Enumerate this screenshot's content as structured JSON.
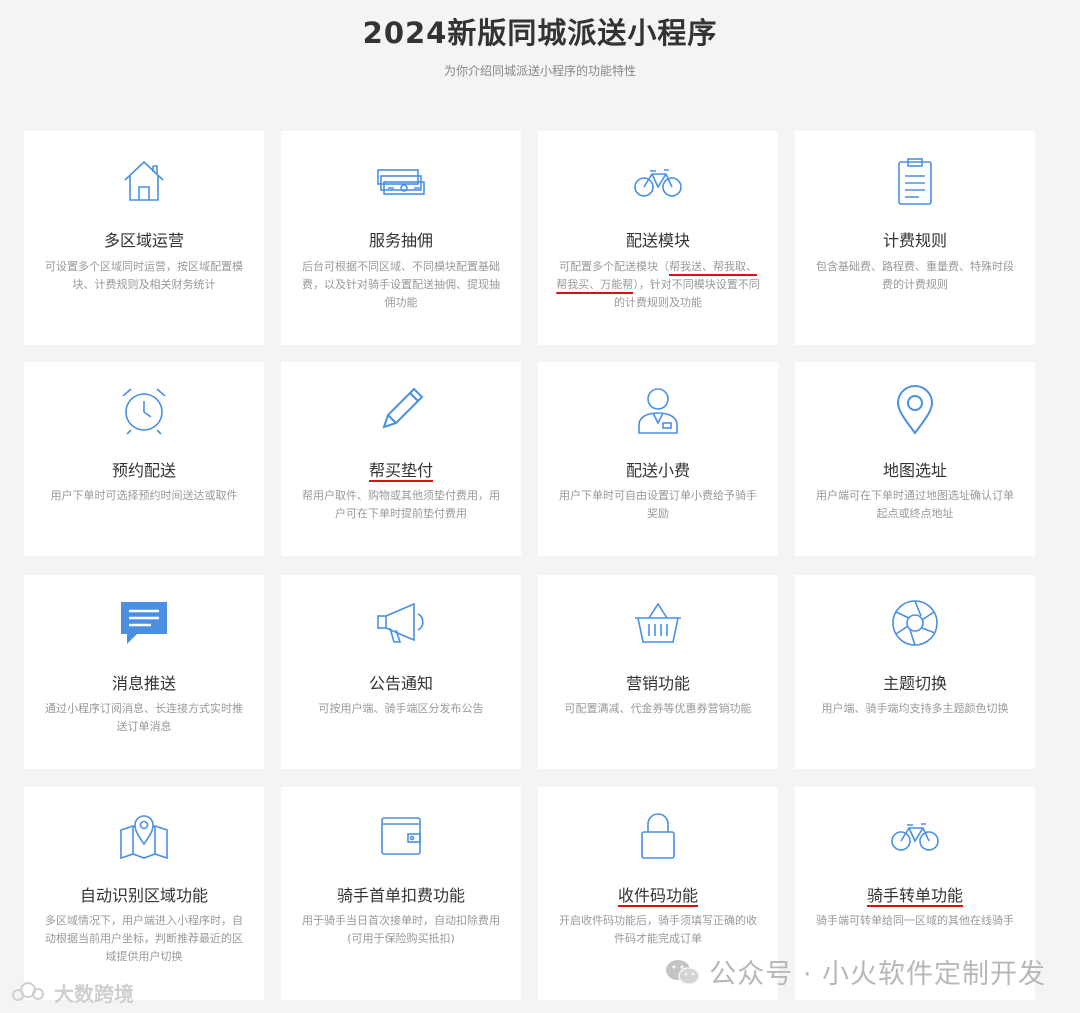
{
  "header": {
    "title": "2024新版同城派送小程序",
    "subtitle": "为你介绍同城派送小程序的功能特性"
  },
  "accent_color": "#4a90e2",
  "highlight_color": "#e01010",
  "cards": [
    {
      "icon": "house-icon",
      "title": "多区域运营",
      "desc": "可设置多个区域同时运营，按区域配置模块、计费规则及相关财务统计"
    },
    {
      "icon": "money-stack-icon",
      "title": "服务抽佣",
      "desc": "后台可根据不同区域、不同模块配置基础费，以及针对骑手设置配送抽佣、提现抽佣功能"
    },
    {
      "icon": "bicycle-icon",
      "title": "配送模块",
      "desc_pre": "可配置多个配送模块（",
      "desc_hl": "帮我送、帮我取、帮我买、万能帮",
      "desc_post": "），针对不同模块设置不同的计费规则及功能"
    },
    {
      "icon": "clipboard-icon",
      "title": "计费规则",
      "desc": "包含基础费、路程费、重量费、特殊时段费的计费规则"
    },
    {
      "icon": "alarm-clock-icon",
      "title": "预约配送",
      "desc": "用户下单时可选择预约时间送达或取件"
    },
    {
      "icon": "pencil-icon",
      "title": "帮买垫付",
      "desc": "帮用户取件、购物或其他须垫付费用，用户可在下单时提前垫付费用",
      "highlight": true
    },
    {
      "icon": "courier-person-icon",
      "title": "配送小费",
      "desc": "用户下单时可自由设置订单小费给予骑手奖励"
    },
    {
      "icon": "map-pin-icon",
      "title": "地图选址",
      "desc": "用户端可在下单时通过地图选址确认订单起点或终点地址"
    },
    {
      "icon": "message-icon",
      "title": "消息推送",
      "desc": "通过小程序订阅消息、长连接方式实时推送订单消息"
    },
    {
      "icon": "megaphone-icon",
      "title": "公告通知",
      "desc": "可按用户端、骑手端区分发布公告"
    },
    {
      "icon": "basket-icon",
      "title": "营销功能",
      "desc": "可配置满减、代金券等优惠券营销功能"
    },
    {
      "icon": "aperture-icon",
      "title": "主题切换",
      "desc": "用户端、骑手端均支持多主题颜色切换"
    },
    {
      "icon": "map-region-icon",
      "title": "自动识别区域功能",
      "desc": "多区域情况下，用户端进入小程序时，自动根据当前用户坐标，判断推荐最近的区域提供用户切换"
    },
    {
      "icon": "wallet-icon",
      "title": "骑手首单扣费功能",
      "desc": "用于骑手当日首次接单时，自动扣除费用(可用于保险购买抵扣)"
    },
    {
      "icon": "padlock-icon",
      "title": "收件码功能",
      "desc": "开启收件码功能后，骑手须填写正确的收件码才能完成订单",
      "highlight": true
    },
    {
      "icon": "bicycle-icon",
      "title": "骑手转单功能",
      "desc": "骑手端可转单给同一区域的其他在线骑手",
      "highlight": true
    }
  ],
  "watermark": {
    "text": "公众号 · 小火软件定制开发",
    "icon": "wechat-icon"
  },
  "corner_logo": {
    "text": "大数跨境",
    "icon": "cloud-logo-icon"
  }
}
